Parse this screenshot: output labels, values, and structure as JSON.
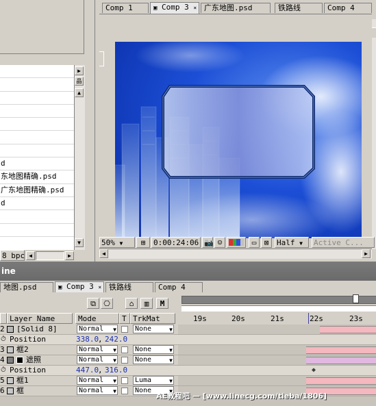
{
  "project": {
    "rows": [
      "",
      "",
      "",
      "",
      "",
      "",
      "",
      "d",
      "东地图精确.psd",
      "广东地图精确.psd",
      "d",
      "",
      ""
    ],
    "bpc_label": "8 bpc"
  },
  "comp": {
    "tabs": [
      "Comp 1",
      "Comp 3",
      "广东地图.psd",
      "铁路线",
      "Comp 4"
    ],
    "active_tab": "Comp 3",
    "zoom": "50%",
    "timecode": "0:00:24:06",
    "resolution": "Half",
    "view": "Active C...",
    "colors": {
      "bg_blue": "#1a55d8",
      "frame_border": "#0e2a6a"
    }
  },
  "timeline": {
    "title": "ine",
    "tabs": [
      "地图.psd",
      "Comp 3",
      "铁路线",
      "Comp 4"
    ],
    "active_tab": "Comp 3",
    "headers": {
      "layer_name": "Layer Name",
      "mode": "Mode",
      "t": "T",
      "trkmat": "TrkMat"
    },
    "ruler": [
      "19s",
      "20s",
      "21s",
      "22s",
      "23s"
    ],
    "layers": [
      {
        "num": "2",
        "name": "[Solid 8]",
        "mode": "Normal",
        "trkmat": "None",
        "kind": "layer",
        "swatch": "#b8b8b8",
        "bar_color": "#f4b8be"
      },
      {
        "num": "",
        "name": "Position",
        "value_x": "338.0",
        "value_y": "242.0",
        "kind": "prop"
      },
      {
        "num": "3",
        "name": "框2",
        "mode": "Normal",
        "trkmat": "None",
        "kind": "layer",
        "swatch": "#c8c8c8",
        "bar_color": "#f4b8be"
      },
      {
        "num": "4",
        "name": "遮照",
        "mode": "Normal",
        "trkmat": "None",
        "kind": "layer",
        "swatch": "#808080",
        "bar_color": "#e0b8e0"
      },
      {
        "num": "",
        "name": "Position",
        "value_x": "447.0",
        "value_y": "316.0",
        "kind": "prop"
      },
      {
        "num": "5",
        "name": "框1",
        "mode": "Normal",
        "trkmat": "Luma",
        "kind": "layer",
        "swatch": "#c8c8c8",
        "bar_color": "#f4b8be"
      },
      {
        "num": "6",
        "name": "框",
        "mode": "Normal",
        "trkmat": "None",
        "kind": "layer",
        "swatch": "#c8c8c8",
        "bar_color": "#f4b8be"
      }
    ],
    "watermark": "AE教程吧 — [www.linecg.com/tieba/1806]"
  }
}
